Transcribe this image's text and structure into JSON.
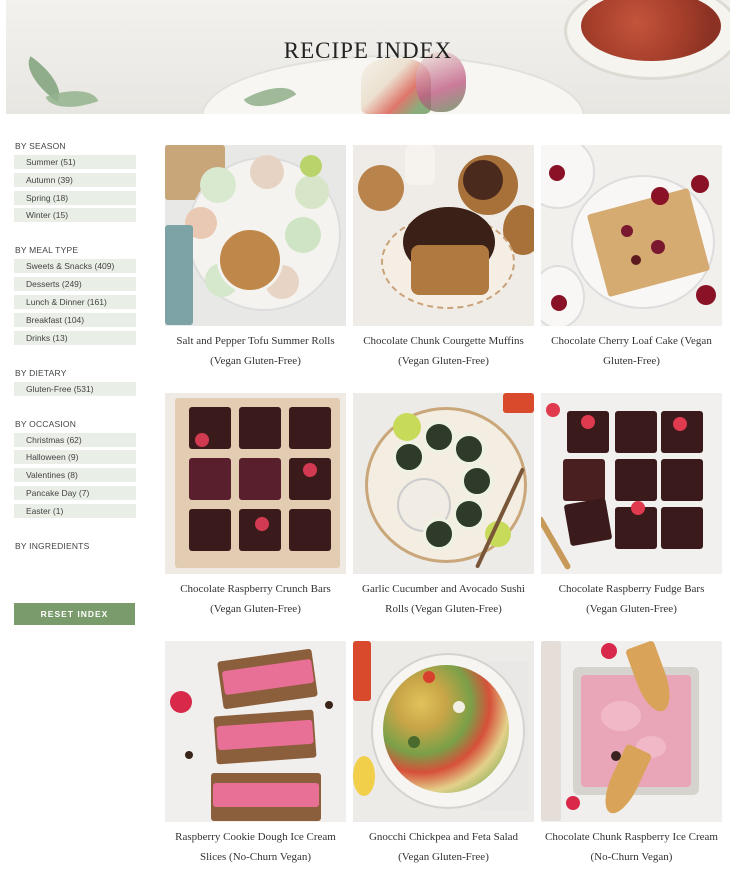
{
  "hero": {
    "title": "RECIPE INDEX"
  },
  "sidebar": {
    "groups": [
      {
        "title": "BY SEASON",
        "items": [
          "Summer (51)",
          "Autumn (39)",
          "Spring (18)",
          "Winter (15)"
        ]
      },
      {
        "title": "BY MEAL TYPE",
        "items": [
          "Sweets & Snacks (409)",
          "Desserts (249)",
          "Lunch & Dinner (161)",
          "Breakfast (104)",
          "Drinks (13)"
        ]
      },
      {
        "title": "BY DIETARY",
        "items": [
          "Gluten-Free (531)"
        ]
      },
      {
        "title": "BY OCCASION",
        "items": [
          "Christmas (62)",
          "Halloween (9)",
          "Valentines (8)",
          "Pancake Day (7)",
          "Easter (1)"
        ]
      },
      {
        "title": "BY INGREDIENTS",
        "items": []
      }
    ],
    "reset_label": "RESET INDEX"
  },
  "recipes": [
    {
      "line1": "Salt and Pepper Tofu Summer Rolls",
      "line2": "(Vegan Gluten-Free)"
    },
    {
      "line1": "Chocolate Chunk Courgette Muffins",
      "line2": "(Vegan Gluten-Free)"
    },
    {
      "line1": "Chocolate Cherry Loaf Cake (Vegan",
      "line2": "Gluten-Free)"
    },
    {
      "line1": "Chocolate Raspberry Crunch Bars",
      "line2": "(Vegan Gluten-Free)"
    },
    {
      "line1": "Garlic Cucumber and Avocado Sushi",
      "line2": "Rolls (Vegan Gluten-Free)"
    },
    {
      "line1": "Chocolate Raspberry Fudge Bars",
      "line2": "(Vegan Gluten-Free)"
    },
    {
      "line1": "Raspberry Cookie Dough Ice Cream",
      "line2": "Slices (No-Churn Vegan)"
    },
    {
      "line1": "Gnocchi Chickpea and Feta Salad",
      "line2": "(Vegan Gluten-Free)"
    },
    {
      "line1": "Chocolate Chunk Raspberry Ice Cream",
      "line2": "(No-Churn Vegan)"
    }
  ],
  "colors": {
    "filter_bg": "#e9eee6",
    "reset_bg": "#7a9b6c",
    "text": "#333333"
  }
}
